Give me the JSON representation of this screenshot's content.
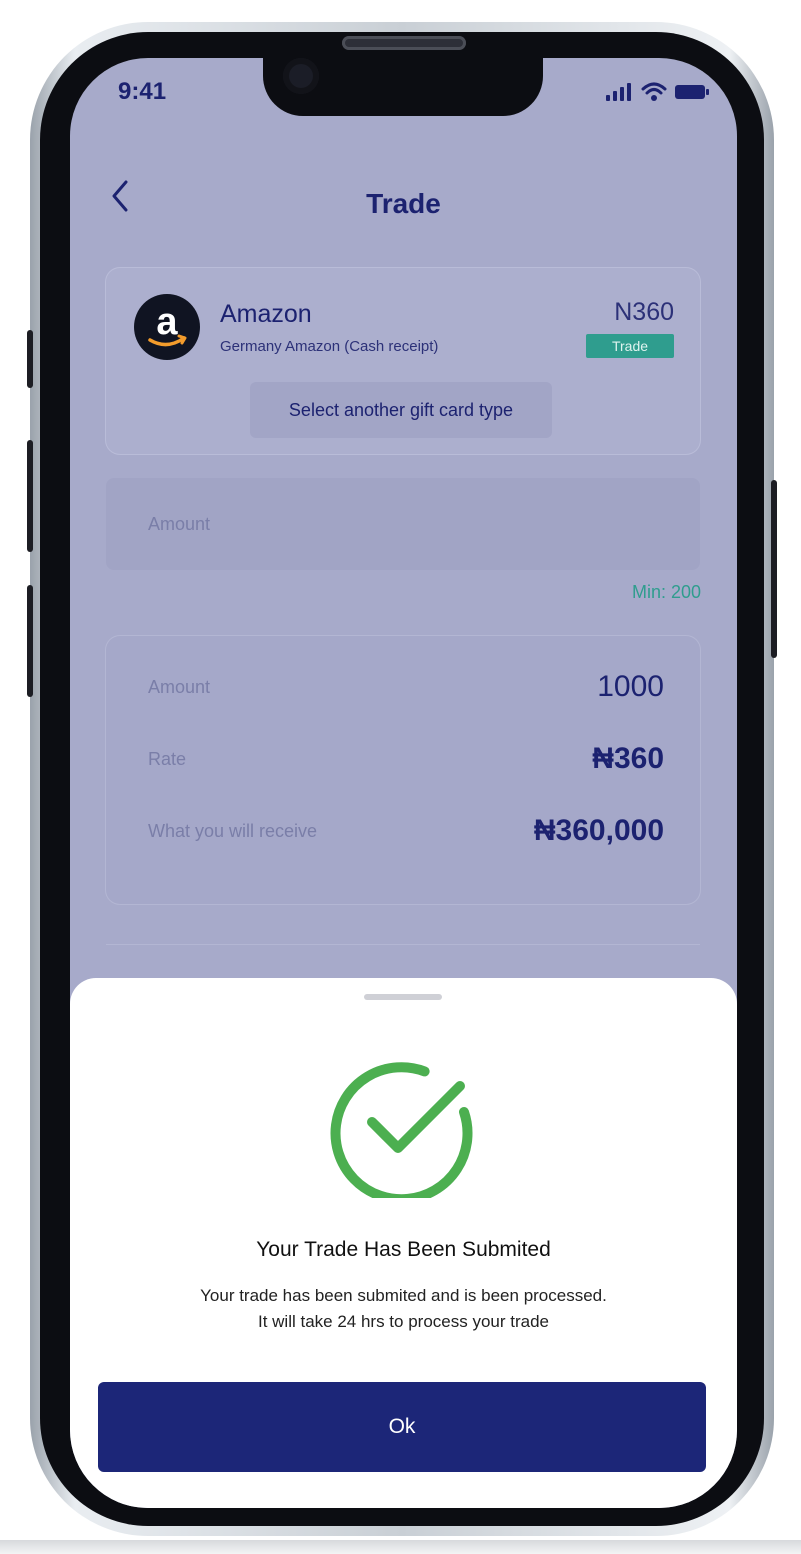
{
  "status_bar": {
    "time": "9:41"
  },
  "header": {
    "title": "Trade"
  },
  "gift_card": {
    "name": "Amazon",
    "subtitle": "Germany Amazon (Cash receipt)",
    "rate": "N360",
    "badge": "Trade",
    "select_label": "Select another gift card type"
  },
  "amount_input": {
    "placeholder": "Amount",
    "min_label": "Min: 200"
  },
  "summary": {
    "rows": [
      {
        "label": "Amount",
        "value": "1000"
      },
      {
        "label": "Rate",
        "value": "₦360"
      },
      {
        "label": "What you will receive",
        "value": "₦360,000"
      }
    ]
  },
  "modal": {
    "title": "Your Trade Has Been Submited",
    "message_line1": "Your trade has been submited and is been processed.",
    "message_line2": "It will take 24 hrs to process your trade",
    "button_label": "Ok"
  },
  "colors": {
    "primary": "#1c2678",
    "accent_green": "#2f9d8e",
    "success": "#4caf50",
    "overlay": "#a7aaca"
  }
}
